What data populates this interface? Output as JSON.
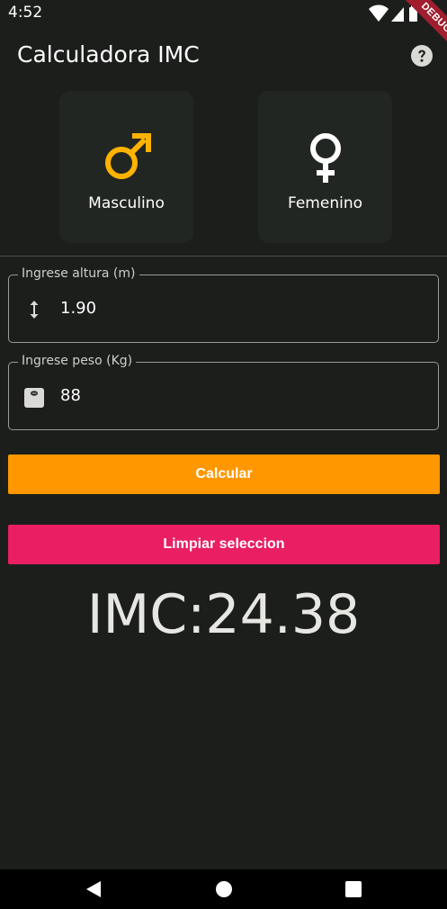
{
  "status_bar": {
    "time": "4:52",
    "debug_label": "DEBUG",
    "icons": [
      "wifi-icon",
      "signal-icon",
      "battery-icon"
    ]
  },
  "app_bar": {
    "title": "Calculadora IMC",
    "help_icon": "help-icon"
  },
  "gender": {
    "male": {
      "label": "Masculino",
      "icon": "male-symbol-icon",
      "color": "#ffb300"
    },
    "female": {
      "label": "Femenino",
      "icon": "female-symbol-icon",
      "color": "#ffffff"
    }
  },
  "inputs": {
    "altura": {
      "label": "Ingrese altura (m)",
      "value": "1.90",
      "icon": "height-arrows-icon"
    },
    "peso": {
      "label": "Ingrese peso (Kg)",
      "value": "88",
      "icon": "scale-icon"
    }
  },
  "buttons": {
    "calcular": {
      "label": "Calcular",
      "color": "#ff9800"
    },
    "limpiar": {
      "label": "Limpiar seleccion",
      "color": "#e91e63"
    }
  },
  "result": {
    "text": "IMC:24.38"
  },
  "nav_bar": {
    "icons": [
      "back-icon",
      "home-icon",
      "recent-apps-icon"
    ]
  }
}
